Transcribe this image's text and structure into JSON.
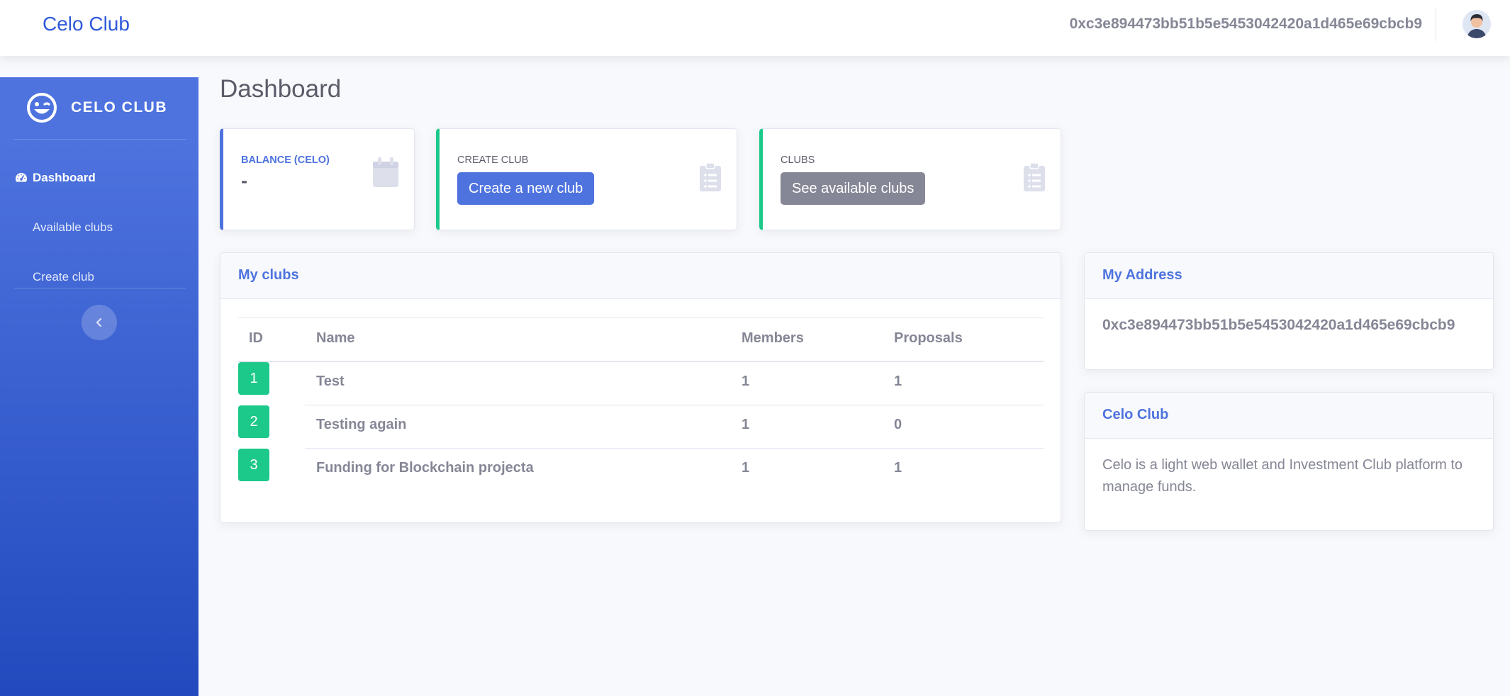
{
  "topbar": {
    "brand": "Celo Club",
    "address": "0xc3e894473bb51b5e5453042420a1d465e69cbcb9"
  },
  "sidebar": {
    "brand": "CELO CLUB",
    "items": [
      {
        "label": "Dashboard",
        "active": true
      },
      {
        "label": "Available clubs",
        "active": false
      },
      {
        "label": "Create club",
        "active": false
      }
    ]
  },
  "page": {
    "title": "Dashboard"
  },
  "cards": {
    "balance": {
      "label": "BALANCE (CELO)",
      "value": "-"
    },
    "create": {
      "label": "CREATE CLUB",
      "button": "Create a new club"
    },
    "clubs": {
      "label": "CLUBS",
      "button": "See available clubs"
    }
  },
  "my_clubs": {
    "title": "My clubs",
    "columns": [
      "ID",
      "Name",
      "Members",
      "Proposals"
    ],
    "rows": [
      {
        "id": "1",
        "name": "Test",
        "members": "1",
        "proposals": "1"
      },
      {
        "id": "2",
        "name": "Testing again",
        "members": "1",
        "proposals": "0"
      },
      {
        "id": "3",
        "name": "Funding for Blockchain projecta",
        "members": "1",
        "proposals": "1"
      }
    ]
  },
  "my_address": {
    "title": "My Address",
    "value": "0xc3e894473bb51b5e5453042420a1d465e69cbcb9"
  },
  "about": {
    "title": "Celo Club",
    "text": "Celo is a light web wallet and Investment Club platform to manage funds."
  },
  "colors": {
    "primary": "#4e73df",
    "success": "#1cc88a",
    "secondary": "#858796"
  }
}
